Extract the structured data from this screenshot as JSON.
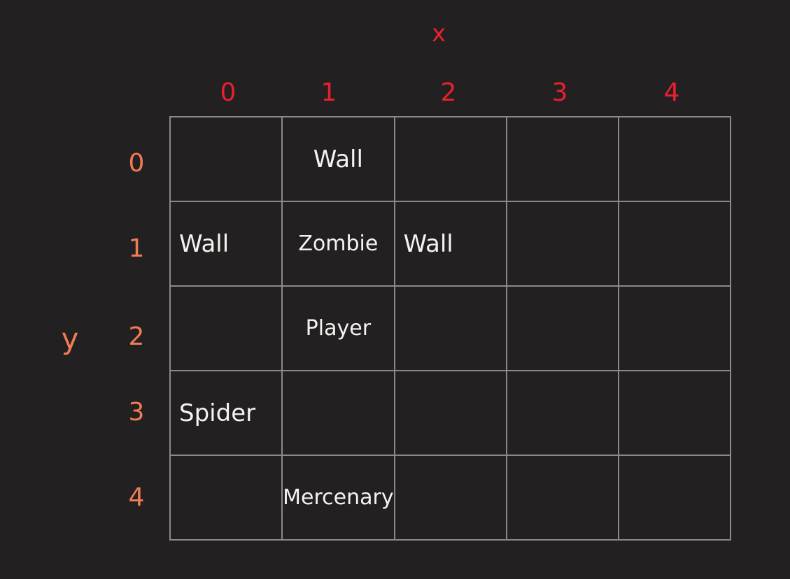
{
  "x_axis": {
    "title": "x",
    "ticks": [
      "0",
      "1",
      "2",
      "3",
      "4"
    ]
  },
  "y_axis": {
    "title": "y",
    "ticks": [
      "0",
      "1",
      "2",
      "3",
      "4"
    ]
  },
  "grid": {
    "rows": [
      [
        "",
        "Wall",
        "",
        "",
        ""
      ],
      [
        "Wall",
        "Zombie",
        "Wall",
        "",
        ""
      ],
      [
        "",
        "Player",
        "",
        "",
        ""
      ],
      [
        "Spider",
        "",
        "",
        "",
        ""
      ],
      [
        "",
        "Mercenary",
        "",
        "",
        ""
      ]
    ]
  },
  "colors": {
    "background": "#222020",
    "x_axis": "#e8212d",
    "y_axis": "#f07c56",
    "grid_line": "#8b8a89",
    "cell_text": "#f4f3ef"
  }
}
